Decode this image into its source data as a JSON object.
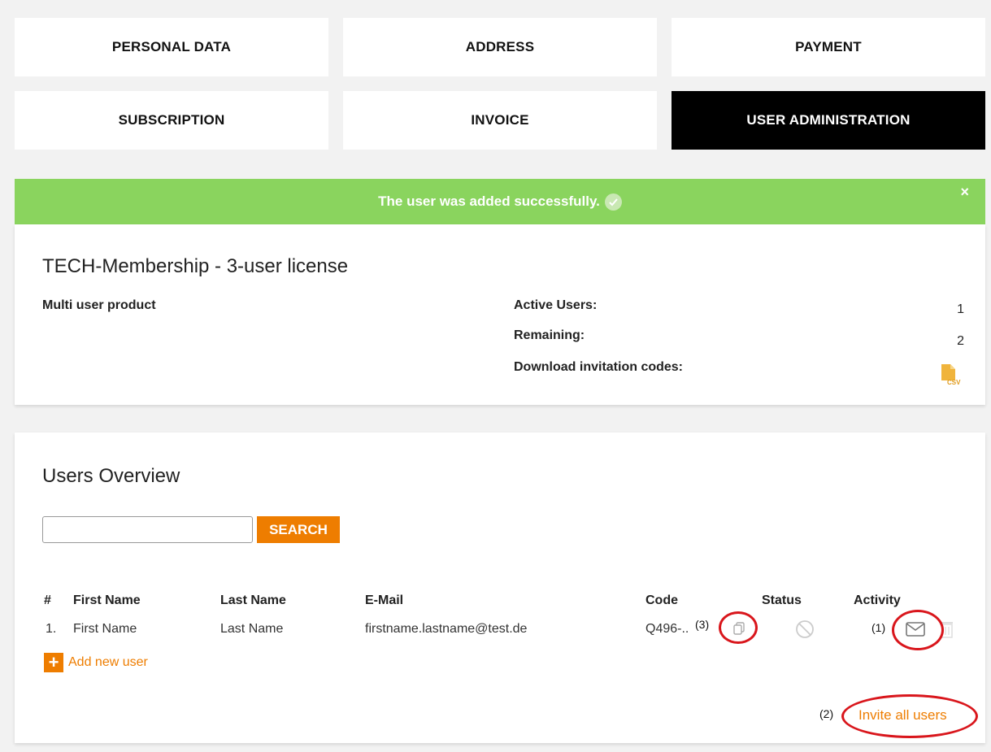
{
  "tabs": [
    "PERSONAL DATA",
    "ADDRESS",
    "PAYMENT",
    "SUBSCRIPTION",
    "INVOICE",
    "USER ADMINISTRATION"
  ],
  "active_tab": "USER ADMINISTRATION",
  "alert": {
    "message": "The user was added successfully.",
    "close": "×"
  },
  "license": {
    "title": "TECH-Membership - 3-user license",
    "product_type": "Multi user product",
    "active_users_label": "Active Users:",
    "active_users_value": "1",
    "remaining_label": "Remaining:",
    "remaining_value": "2",
    "download_label": "Download invitation codes:",
    "download_icon": "csv-file-icon",
    "csv_label": "CSV"
  },
  "users_overview": {
    "title": "Users Overview",
    "search_value": "",
    "search_button": "SEARCH",
    "columns": [
      "#",
      "First Name",
      "Last Name",
      "E-Mail",
      "Code",
      "Status",
      "Activity"
    ],
    "rows": [
      {
        "num": "1.",
        "first_name": "First Name",
        "last_name": "Last Name",
        "email": "firstname.lastname@test.de",
        "code": "Q496-.."
      }
    ],
    "add_user": "Add new user",
    "invite_all": "Invite all users"
  },
  "annotations": {
    "one": "(1)",
    "two": "(2)",
    "three": "(3)"
  },
  "colors": {
    "accent": "#ee7d00",
    "success": "#8ad45e",
    "active_tab": "#000000",
    "annotation": "#d9161c"
  }
}
